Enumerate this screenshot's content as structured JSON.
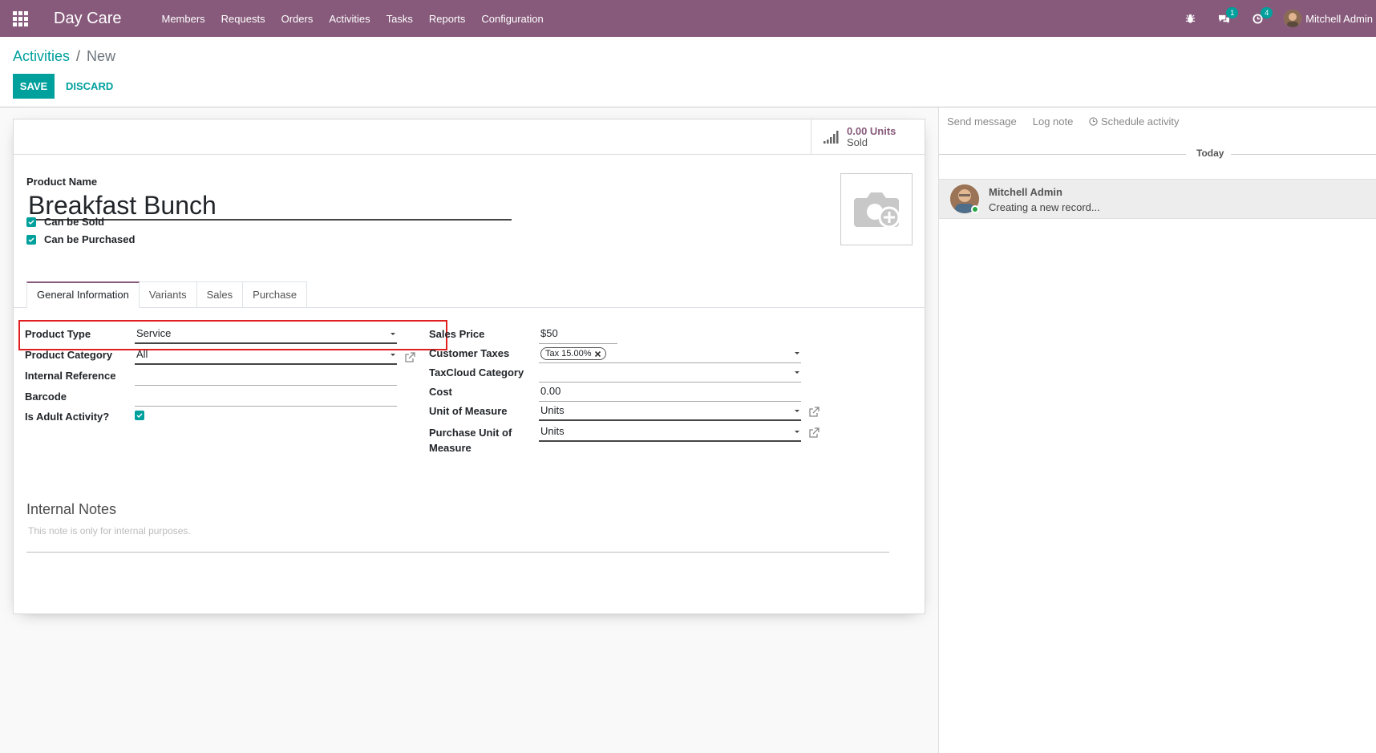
{
  "navbar": {
    "brand": "Day Care",
    "menu": [
      "Members",
      "Requests",
      "Orders",
      "Activities",
      "Tasks",
      "Reports",
      "Configuration"
    ],
    "messages_count": "1",
    "activities_count": "4",
    "user_name": "Mitchell Admin"
  },
  "control_panel": {
    "breadcrumb_parent": "Activities",
    "breadcrumb_separator": "/",
    "breadcrumb_current": "New",
    "save_label": "SAVE",
    "discard_label": "DISCARD"
  },
  "stat_button": {
    "value": "0.00 Units",
    "label": "Sold"
  },
  "form": {
    "product_name_label": "Product Name",
    "product_name": "Breakfast Bunch",
    "can_be_sold": "Can be Sold",
    "can_be_purchased": "Can be Purchased",
    "tabs": [
      "General Information",
      "Variants",
      "Sales",
      "Purchase"
    ],
    "left": {
      "product_type_label": "Product Type",
      "product_type": "Service",
      "product_category_label": "Product Category",
      "product_category": "All",
      "internal_reference_label": "Internal Reference",
      "barcode_label": "Barcode",
      "is_adult_label": "Is Adult Activity?"
    },
    "right": {
      "sales_price_label": "Sales Price",
      "currency": "$",
      "sales_price": "50",
      "customer_taxes_label": "Customer Taxes",
      "tax_tag": "Tax 15.00%",
      "taxcloud_label": "TaxCloud Category",
      "cost_label": "Cost",
      "cost": "0.00",
      "uom_label": "Unit of Measure",
      "uom": "Units",
      "purchase_uom_label_1": "Purchase Unit of",
      "purchase_uom_label_2": "Measure",
      "purchase_uom": "Units"
    },
    "notes_title": "Internal Notes",
    "notes_placeholder": "This note is only for internal purposes."
  },
  "chatter": {
    "send_message": "Send message",
    "log_note": "Log note",
    "schedule_activity": "Schedule activity",
    "today": "Today",
    "message_author": "Mitchell Admin",
    "message_body": "Creating a new record..."
  },
  "colors": {
    "primary": "#875a7b",
    "accent": "#00a09d",
    "highlight": "#e02020"
  }
}
